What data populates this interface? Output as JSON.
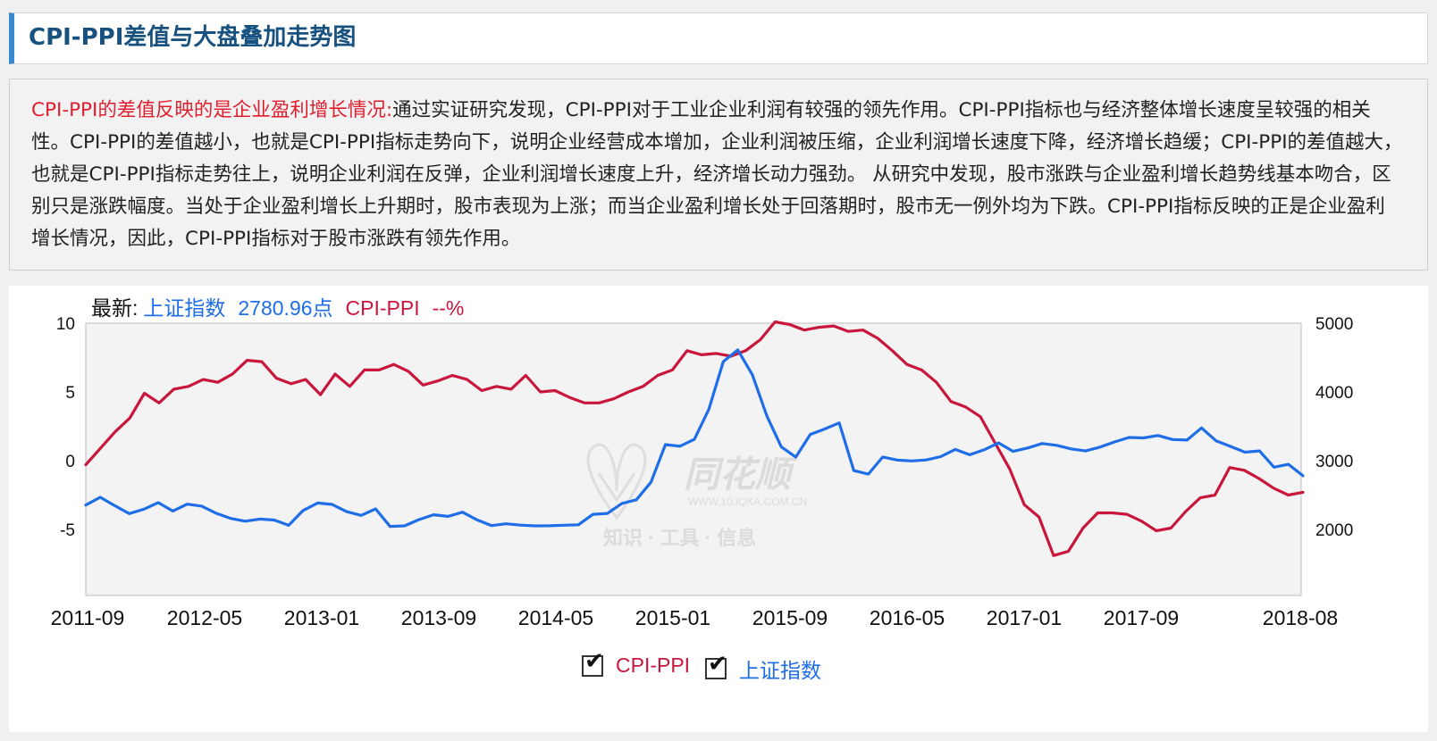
{
  "page": {
    "title": "CPI-PPI差值与大盘叠加走势图",
    "description_lead": "CPI-PPI的差值反映的是企业盈利增长情况:",
    "description_body": "通过实证研究发现，CPI-PPI对于工业企业利润有较强的领先作用。CPI-PPI指标也与经济整体增长速度呈较强的相关性。CPI-PPI的差值越小，也就是CPI-PPI指标走势向下，说明企业经营成本增加，企业利润被压缩，企业利润增长速度下降，经济增长趋缓；CPI-PPI的差值越大，也就是CPI-PPI指标走势往上，说明企业利润在反弹，企业利润增长速度上升，经济增长动力强劲。 从研究中发现，股市涨跌与企业盈利增长趋势线基本吻合，区别只是涨跌幅度。当处于企业盈利增长上升期时，股市表现为上涨；而当企业盈利增长处于回落期时，股市无一例外均为下跌。CPI-PPI指标反映的正是企业盈利增长情况，因此，CPI-PPI指标对于股市涨跌有领先作用。"
  },
  "latest": {
    "prefix": "最新:",
    "index_name": "上证指数",
    "index_value": "2780.96点",
    "cpi_name": "CPI-PPI",
    "cpi_value": "--%"
  },
  "legend": {
    "items": [
      {
        "label": "CPI-PPI",
        "checked": true,
        "color": "#c8163c",
        "check_glyph": "✔"
      },
      {
        "label": "上证指数",
        "checked": true,
        "color": "#1f6ee8",
        "check_glyph": "✔"
      }
    ]
  },
  "watermark": {
    "brand": "同花顺",
    "url": "WWW.10JQKA.COM.CN",
    "slogan": "知识 · 工具 · 信息"
  },
  "chart_data": {
    "type": "line",
    "x_ticks": [
      "2011-09",
      "2012-05",
      "2013-01",
      "2013-09",
      "2014-05",
      "2015-01",
      "2015-09",
      "2016-05",
      "2017-01",
      "2017-09",
      "2018-08"
    ],
    "y_left": {
      "ticks": [
        "10",
        "5",
        "0",
        "-5"
      ],
      "range": [
        -10,
        10
      ]
    },
    "y_right": {
      "ticks": [
        "5000",
        "4000",
        "3000",
        "2000"
      ],
      "range": [
        1000,
        5000
      ]
    },
    "series": [
      {
        "name": "CPI-PPI",
        "axis": "left",
        "color": "#c8163c",
        "values": [
          -0.3,
          0.9,
          2.1,
          3.1,
          4.9,
          4.2,
          5.2,
          5.4,
          5.9,
          5.7,
          6.3,
          7.3,
          7.2,
          6.0,
          5.6,
          5.9,
          4.8,
          6.3,
          5.4,
          6.6,
          6.6,
          7.0,
          6.5,
          5.5,
          5.8,
          6.2,
          5.9,
          5.1,
          5.4,
          5.2,
          6.2,
          5.0,
          5.1,
          4.6,
          4.2,
          4.2,
          4.5,
          5.0,
          5.4,
          6.2,
          6.6,
          8.0,
          7.7,
          7.8,
          7.6,
          8.0,
          8.8,
          10.1,
          9.9,
          9.5,
          9.7,
          9.8,
          9.4,
          9.5,
          8.9,
          8.0,
          7.0,
          6.6,
          5.7,
          4.3,
          3.9,
          3.2,
          1.3,
          -0.6,
          -3.2,
          -4.1,
          -6.9,
          -6.6,
          -4.9,
          -3.8,
          -3.8,
          -3.9,
          -4.4,
          -5.1,
          -4.9,
          -3.7,
          -2.7,
          -2.5,
          -0.5,
          -0.7,
          -1.3,
          -2.0,
          -2.5,
          -2.3
        ]
      },
      {
        "name": "上证指数",
        "axis": "right",
        "color": "#1f6ee8",
        "values": [
          2355,
          2468,
          2346,
          2230,
          2293,
          2390,
          2268,
          2367,
          2339,
          2235,
          2160,
          2120,
          2151,
          2137,
          2060,
          2275,
          2385,
          2364,
          2258,
          2204,
          2299,
          2043,
          2052,
          2143,
          2213,
          2189,
          2251,
          2139,
          2056,
          2082,
          2062,
          2052,
          2053,
          2061,
          2068,
          2220,
          2233,
          2378,
          2431,
          2686,
          3234,
          3210,
          3310,
          3748,
          4442,
          4612,
          4250,
          3650,
          3200,
          3052,
          3382,
          3461,
          3549,
          2856,
          2804,
          3053,
          3009,
          2996,
          3010,
          3058,
          3164,
          3086,
          3158,
          3259,
          3135,
          3184,
          3250,
          3224,
          3172,
          3142,
          3197,
          3273,
          3338,
          3331,
          3366,
          3308,
          3300,
          3477,
          3289,
          3208,
          3124,
          3141,
          2905,
          2947,
          2780
        ]
      }
    ],
    "xlabel": "",
    "ylabel": "",
    "grid": false,
    "legend_position": "bottom-center"
  }
}
